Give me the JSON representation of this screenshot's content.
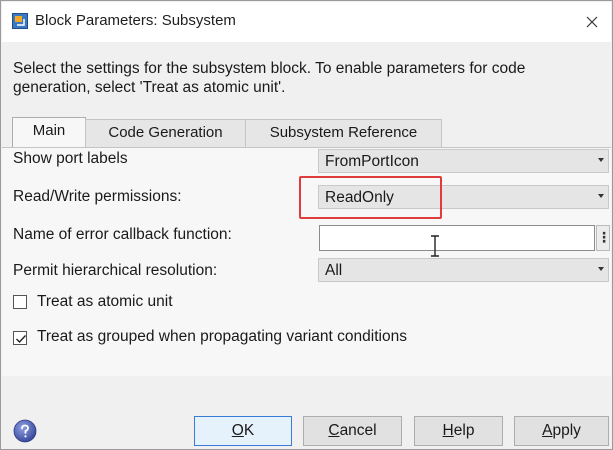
{
  "window": {
    "title": "Block Parameters: Subsystem",
    "icon": "simulink-block-icon",
    "close_icon": "close-icon"
  },
  "description": "Select the settings for the subsystem block. To enable parameters for code generation, select 'Treat as atomic unit'.",
  "tabs": [
    {
      "label": "Main",
      "active": true
    },
    {
      "label": "Code Generation",
      "active": false
    },
    {
      "label": "Subsystem Reference",
      "active": false
    }
  ],
  "params": {
    "show_port_labels": {
      "label": "Show port labels",
      "value": "FromPortIcon"
    },
    "read_write": {
      "label": "Read/Write permissions:",
      "value": "ReadOnly"
    },
    "error_callback": {
      "label": "Name of error callback function:",
      "value": ""
    },
    "hier_resolution": {
      "label": "Permit hierarchical resolution:",
      "value": "All"
    }
  },
  "checkboxes": {
    "atomic": {
      "label": "Treat as atomic unit",
      "checked": false
    },
    "grouped": {
      "label": "Treat as grouped when propagating variant conditions",
      "checked": true
    }
  },
  "more_button": "⋮",
  "buttons": {
    "ok": {
      "label": "OK",
      "mnemonic": "O",
      "rest": "K"
    },
    "cancel": {
      "label": "Cancel",
      "mnemonic": "C",
      "rest": "ancel"
    },
    "help": {
      "label": "Help",
      "mnemonic": "H",
      "rest": "elp"
    },
    "apply": {
      "label": "Apply",
      "mnemonic": "A",
      "rest": "pply"
    }
  },
  "colors": {
    "highlight": "#e03c3c",
    "help_icon": "#4a5aa8"
  }
}
